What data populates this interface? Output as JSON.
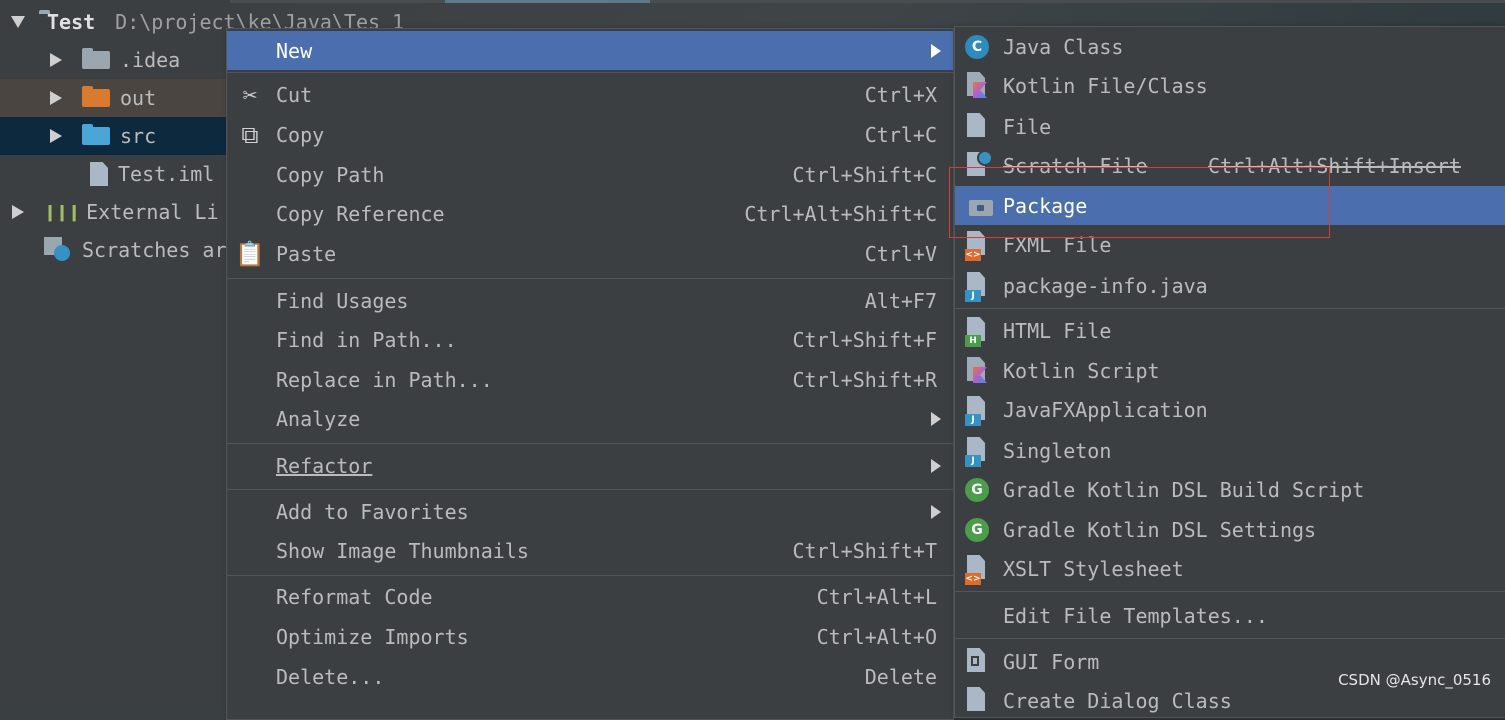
{
  "tree": {
    "root_name": "Test",
    "root_path": "D:\\project\\ke\\Java\\Tes 1",
    "items": [
      {
        "label": ".idea"
      },
      {
        "label": "out"
      },
      {
        "label": "src"
      },
      {
        "label": "Test.iml"
      },
      {
        "label": "External Li"
      },
      {
        "label": "Scratches ar"
      }
    ]
  },
  "menu": {
    "items": [
      {
        "label": "New",
        "shortcut": ""
      },
      {
        "label": "Cut",
        "shortcut": "Ctrl+X"
      },
      {
        "label": "Copy",
        "shortcut": "Ctrl+C"
      },
      {
        "label": "Copy Path",
        "shortcut": "Ctrl+Shift+C"
      },
      {
        "label": "Copy Reference",
        "shortcut": "Ctrl+Alt+Shift+C"
      },
      {
        "label": "Paste",
        "shortcut": "Ctrl+V"
      },
      {
        "label": "Find Usages",
        "shortcut": "Alt+F7"
      },
      {
        "label": "Find in Path...",
        "shortcut": "Ctrl+Shift+F"
      },
      {
        "label": "Replace in Path...",
        "shortcut": "Ctrl+Shift+R"
      },
      {
        "label": "Analyze",
        "shortcut": ""
      },
      {
        "label": "Refactor",
        "shortcut": ""
      },
      {
        "label": "Add to Favorites",
        "shortcut": ""
      },
      {
        "label": "Show Image Thumbnails",
        "shortcut": "Ctrl+Shift+T"
      },
      {
        "label": "Reformat Code",
        "shortcut": "Ctrl+Alt+L"
      },
      {
        "label": "Optimize Imports",
        "shortcut": "Ctrl+Alt+O"
      },
      {
        "label": "Delete...",
        "shortcut": "Delete"
      }
    ]
  },
  "submenu": {
    "items": [
      {
        "label": "Java Class",
        "icon": "java-class-icon"
      },
      {
        "label": "Kotlin File/Class",
        "icon": "kotlin-file-icon"
      },
      {
        "label": "File",
        "icon": "file-icon"
      },
      {
        "label": "Scratch File",
        "shortcut": "Ctrl+Alt+Shift+Insert",
        "icon": "scratch-file-icon"
      },
      {
        "label": "Package",
        "icon": "package-icon"
      },
      {
        "label": "FXML File",
        "icon": "fxml-file-icon"
      },
      {
        "label": "package-info.java",
        "icon": "java-file-icon"
      },
      {
        "label": "HTML File",
        "icon": "html-file-icon"
      },
      {
        "label": "Kotlin Script",
        "icon": "kotlin-script-icon"
      },
      {
        "label": "JavaFXApplication",
        "icon": "java-file-icon"
      },
      {
        "label": "Singleton",
        "icon": "java-file-icon"
      },
      {
        "label": "Gradle Kotlin DSL Build Script",
        "icon": "gradle-icon"
      },
      {
        "label": "Gradle Kotlin DSL Settings",
        "icon": "gradle-icon"
      },
      {
        "label": "XSLT Stylesheet",
        "icon": "xslt-file-icon"
      },
      {
        "label": "Edit File Templates...",
        "icon": ""
      },
      {
        "label": "GUI Form",
        "icon": "gui-form-icon"
      },
      {
        "label": "Create Dialog Class",
        "icon": "file-icon"
      }
    ]
  },
  "watermark": "CSDN @Async_0516",
  "colors": {
    "highlight": "#4b6eaf",
    "selection_box": "#d83b3b"
  }
}
